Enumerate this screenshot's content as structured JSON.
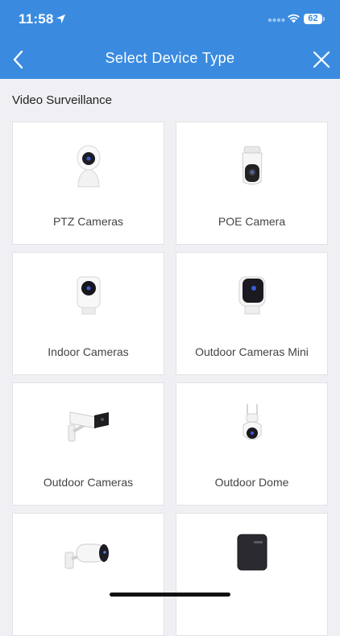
{
  "status_bar": {
    "time": "11:58",
    "battery": "62",
    "icons": [
      "location-arrow-icon",
      "signal-icon",
      "wifi-icon",
      "battery-icon"
    ]
  },
  "header": {
    "title": "Select Device Type",
    "back_icon": "chevron-left-icon",
    "close_icon": "close-icon",
    "background_color": "#3a8be0"
  },
  "section": {
    "title": "Video Surveillance"
  },
  "devices": [
    {
      "label": "PTZ Cameras",
      "icon": "ptz-camera-icon"
    },
    {
      "label": "POE Camera",
      "icon": "poe-camera-icon"
    },
    {
      "label": "Indoor Cameras",
      "icon": "indoor-camera-icon"
    },
    {
      "label": "Outdoor Cameras Mini",
      "icon": "outdoor-camera-mini-icon"
    },
    {
      "label": "Outdoor Cameras",
      "icon": "outdoor-camera-icon"
    },
    {
      "label": "Outdoor Dome",
      "icon": "outdoor-dome-icon"
    },
    {
      "label": "",
      "icon": "bullet-camera-icon"
    },
    {
      "label": "",
      "icon": "base-station-icon"
    }
  ]
}
